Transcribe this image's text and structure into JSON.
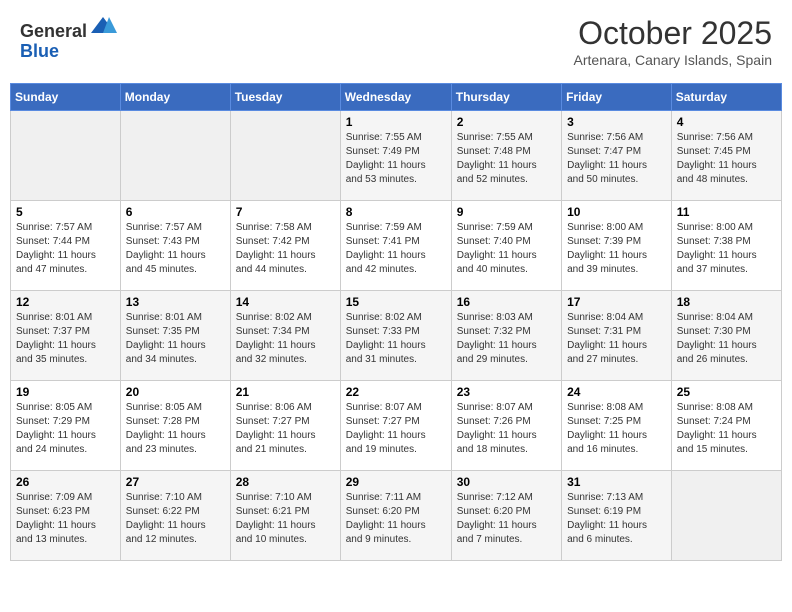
{
  "logo": {
    "text_general": "General",
    "text_blue": "Blue"
  },
  "header": {
    "month": "October 2025",
    "location": "Artenara, Canary Islands, Spain"
  },
  "weekdays": [
    "Sunday",
    "Monday",
    "Tuesday",
    "Wednesday",
    "Thursday",
    "Friday",
    "Saturday"
  ],
  "weeks": [
    [
      {
        "day": "",
        "info": ""
      },
      {
        "day": "",
        "info": ""
      },
      {
        "day": "",
        "info": ""
      },
      {
        "day": "1",
        "info": "Sunrise: 7:55 AM\nSunset: 7:49 PM\nDaylight: 11 hours\nand 53 minutes."
      },
      {
        "day": "2",
        "info": "Sunrise: 7:55 AM\nSunset: 7:48 PM\nDaylight: 11 hours\nand 52 minutes."
      },
      {
        "day": "3",
        "info": "Sunrise: 7:56 AM\nSunset: 7:47 PM\nDaylight: 11 hours\nand 50 minutes."
      },
      {
        "day": "4",
        "info": "Sunrise: 7:56 AM\nSunset: 7:45 PM\nDaylight: 11 hours\nand 48 minutes."
      }
    ],
    [
      {
        "day": "5",
        "info": "Sunrise: 7:57 AM\nSunset: 7:44 PM\nDaylight: 11 hours\nand 47 minutes."
      },
      {
        "day": "6",
        "info": "Sunrise: 7:57 AM\nSunset: 7:43 PM\nDaylight: 11 hours\nand 45 minutes."
      },
      {
        "day": "7",
        "info": "Sunrise: 7:58 AM\nSunset: 7:42 PM\nDaylight: 11 hours\nand 44 minutes."
      },
      {
        "day": "8",
        "info": "Sunrise: 7:59 AM\nSunset: 7:41 PM\nDaylight: 11 hours\nand 42 minutes."
      },
      {
        "day": "9",
        "info": "Sunrise: 7:59 AM\nSunset: 7:40 PM\nDaylight: 11 hours\nand 40 minutes."
      },
      {
        "day": "10",
        "info": "Sunrise: 8:00 AM\nSunset: 7:39 PM\nDaylight: 11 hours\nand 39 minutes."
      },
      {
        "day": "11",
        "info": "Sunrise: 8:00 AM\nSunset: 7:38 PM\nDaylight: 11 hours\nand 37 minutes."
      }
    ],
    [
      {
        "day": "12",
        "info": "Sunrise: 8:01 AM\nSunset: 7:37 PM\nDaylight: 11 hours\nand 35 minutes."
      },
      {
        "day": "13",
        "info": "Sunrise: 8:01 AM\nSunset: 7:35 PM\nDaylight: 11 hours\nand 34 minutes."
      },
      {
        "day": "14",
        "info": "Sunrise: 8:02 AM\nSunset: 7:34 PM\nDaylight: 11 hours\nand 32 minutes."
      },
      {
        "day": "15",
        "info": "Sunrise: 8:02 AM\nSunset: 7:33 PM\nDaylight: 11 hours\nand 31 minutes."
      },
      {
        "day": "16",
        "info": "Sunrise: 8:03 AM\nSunset: 7:32 PM\nDaylight: 11 hours\nand 29 minutes."
      },
      {
        "day": "17",
        "info": "Sunrise: 8:04 AM\nSunset: 7:31 PM\nDaylight: 11 hours\nand 27 minutes."
      },
      {
        "day": "18",
        "info": "Sunrise: 8:04 AM\nSunset: 7:30 PM\nDaylight: 11 hours\nand 26 minutes."
      }
    ],
    [
      {
        "day": "19",
        "info": "Sunrise: 8:05 AM\nSunset: 7:29 PM\nDaylight: 11 hours\nand 24 minutes."
      },
      {
        "day": "20",
        "info": "Sunrise: 8:05 AM\nSunset: 7:28 PM\nDaylight: 11 hours\nand 23 minutes."
      },
      {
        "day": "21",
        "info": "Sunrise: 8:06 AM\nSunset: 7:27 PM\nDaylight: 11 hours\nand 21 minutes."
      },
      {
        "day": "22",
        "info": "Sunrise: 8:07 AM\nSunset: 7:27 PM\nDaylight: 11 hours\nand 19 minutes."
      },
      {
        "day": "23",
        "info": "Sunrise: 8:07 AM\nSunset: 7:26 PM\nDaylight: 11 hours\nand 18 minutes."
      },
      {
        "day": "24",
        "info": "Sunrise: 8:08 AM\nSunset: 7:25 PM\nDaylight: 11 hours\nand 16 minutes."
      },
      {
        "day": "25",
        "info": "Sunrise: 8:08 AM\nSunset: 7:24 PM\nDaylight: 11 hours\nand 15 minutes."
      }
    ],
    [
      {
        "day": "26",
        "info": "Sunrise: 7:09 AM\nSunset: 6:23 PM\nDaylight: 11 hours\nand 13 minutes."
      },
      {
        "day": "27",
        "info": "Sunrise: 7:10 AM\nSunset: 6:22 PM\nDaylight: 11 hours\nand 12 minutes."
      },
      {
        "day": "28",
        "info": "Sunrise: 7:10 AM\nSunset: 6:21 PM\nDaylight: 11 hours\nand 10 minutes."
      },
      {
        "day": "29",
        "info": "Sunrise: 7:11 AM\nSunset: 6:20 PM\nDaylight: 11 hours\nand 9 minutes."
      },
      {
        "day": "30",
        "info": "Sunrise: 7:12 AM\nSunset: 6:20 PM\nDaylight: 11 hours\nand 7 minutes."
      },
      {
        "day": "31",
        "info": "Sunrise: 7:13 AM\nSunset: 6:19 PM\nDaylight: 11 hours\nand 6 minutes."
      },
      {
        "day": "",
        "info": ""
      }
    ]
  ]
}
